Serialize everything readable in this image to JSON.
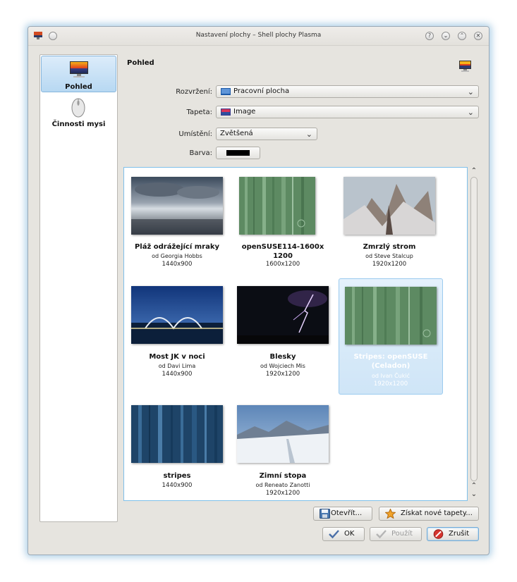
{
  "window": {
    "title": "Nastavení plochy – Shell plochy Plasma"
  },
  "titlebar_buttons": [
    {
      "name": "help-button",
      "glyph": "?"
    },
    {
      "name": "minimize-button",
      "glyph": "⌄"
    },
    {
      "name": "maximize-button",
      "glyph": "⌃"
    },
    {
      "name": "close-button",
      "glyph": "✕"
    }
  ],
  "sidebar": {
    "items": [
      {
        "label": "Pohled",
        "icon": "monitor-wallpaper-icon",
        "active": true
      },
      {
        "label": "Činnosti mysi",
        "icon": "mouse-icon",
        "active": false
      }
    ]
  },
  "content": {
    "title": "Pohled",
    "header_icon": "monitor-wallpaper-icon"
  },
  "form": {
    "layout_label": "Rozvržení:",
    "layout_value": "Pracovní plocha",
    "wallpaper_label": "Tapeta:",
    "wallpaper_value": "Image",
    "position_label": "Umístění:",
    "position_value": "Zvětšená",
    "color_label": "Barva:",
    "color_value": "#000000"
  },
  "wallpapers": [
    {
      "name": "Pláž odrážející mraky",
      "author": "od Georgia Hobbs",
      "resolution": "1440x900",
      "selected": false,
      "style": "beach"
    },
    {
      "name": "openSUSE114-1600x1200",
      "author": "",
      "resolution": "1600x1200",
      "selected": false,
      "style": "green-stripes"
    },
    {
      "name": "Zmrzlý strom",
      "author": "od Steve Stalcup",
      "resolution": "1920x1200",
      "selected": false,
      "style": "frozen-tree"
    },
    {
      "name": "Most JK v noci",
      "author": "od Davi Lima",
      "resolution": "1440x900",
      "selected": false,
      "style": "bridge-night"
    },
    {
      "name": "Blesky",
      "author": "od Wojciech Mis",
      "resolution": "1920x1200",
      "selected": false,
      "style": "lightning"
    },
    {
      "name": "Stripes: openSUSE (Celadon)",
      "author": "od Ivan Čukić",
      "resolution": "1920x1200",
      "selected": true,
      "style": "green-stripes"
    },
    {
      "name": "stripes",
      "author": "",
      "resolution": "1440x900",
      "selected": false,
      "style": "blue-stripes"
    },
    {
      "name": "Zimní stopa",
      "author": "od Reneato Zanotti",
      "resolution": "1920x1200",
      "selected": false,
      "style": "snow"
    }
  ],
  "buttons": {
    "open": "Otevřít...",
    "get_new": "Získat nové tapety...",
    "ok": "OK",
    "apply": "Použít",
    "cancel": "Zrušit"
  },
  "colors": {
    "accent": "#7fc0ea",
    "selection": "#cfe5f7"
  }
}
